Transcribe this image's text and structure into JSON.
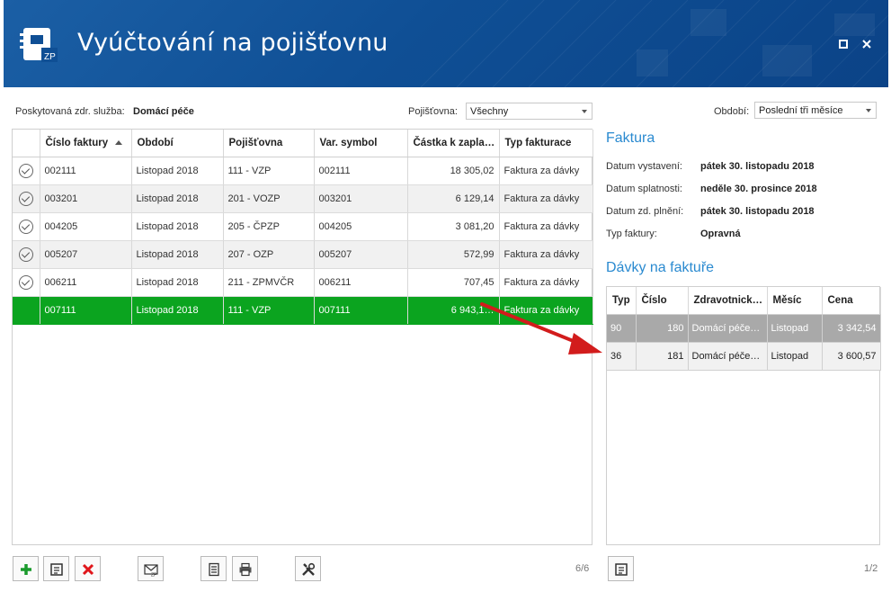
{
  "window": {
    "title": "Vyúčtování na pojišťovnu",
    "logo_text": "ZP"
  },
  "filters": {
    "service_label": "Poskytovaná zdr. služba:",
    "service_value": "Domácí péče",
    "insurer_label": "Pojišťovna:",
    "insurer_value": "Všechny",
    "period_label": "Období:",
    "period_value": "Poslední tři měsíce"
  },
  "invoices": {
    "columns": [
      "Číslo faktury",
      "Období",
      "Pojišťovna",
      "Var. symbol",
      "Částka k zapla…",
      "Typ fakturace"
    ],
    "rows": [
      {
        "cislo": "002111",
        "obdobi": "Listopad 2018",
        "pojistovna": "111 - VZP",
        "vs": "002111",
        "castka": "18 305,02",
        "typ": "Faktura za dávky"
      },
      {
        "cislo": "003201",
        "obdobi": "Listopad 2018",
        "pojistovna": "201 - VOZP",
        "vs": "003201",
        "castka": "6 129,14",
        "typ": "Faktura za dávky"
      },
      {
        "cislo": "004205",
        "obdobi": "Listopad 2018",
        "pojistovna": "205 - ČPZP",
        "vs": "004205",
        "castka": "3 081,20",
        "typ": "Faktura za dávky"
      },
      {
        "cislo": "005207",
        "obdobi": "Listopad 2018",
        "pojistovna": "207 - OZP",
        "vs": "005207",
        "castka": "572,99",
        "typ": "Faktura za dávky"
      },
      {
        "cislo": "006211",
        "obdobi": "Listopad 2018",
        "pojistovna": "211 - ZPMVČR",
        "vs": "006211",
        "castka": "707,45",
        "typ": "Faktura za dávky"
      },
      {
        "cislo": "007111",
        "obdobi": "Listopad 2018",
        "pojistovna": "111 - VZP",
        "vs": "007111",
        "castka": "6 943,1…",
        "typ": "Faktura za dávky"
      }
    ],
    "counter": "6/6"
  },
  "invoice_detail": {
    "title": "Faktura",
    "fields": [
      {
        "label": "Datum vystavení:",
        "value": "pátek 30. listopadu 2018"
      },
      {
        "label": "Datum splatnosti:",
        "value": "neděle 30. prosince 2018"
      },
      {
        "label": "Datum zd. plnění:",
        "value": "pátek 30. listopadu 2018"
      },
      {
        "label": "Typ faktury:",
        "value": "Opravná"
      }
    ]
  },
  "batches": {
    "title": "Dávky na faktuře",
    "columns": [
      "Typ",
      "Číslo",
      "Zdravotnick…",
      "Měsíc",
      "Cena"
    ],
    "rows": [
      {
        "typ": "90",
        "cislo": "180",
        "zdrav": "Domácí péče…",
        "mesic": "Listopad",
        "cena": "3 342,54"
      },
      {
        "typ": "36",
        "cislo": "181",
        "zdrav": "Domácí péče…",
        "mesic": "Listopad",
        "cena": "3 600,57"
      }
    ],
    "counter": "1/2"
  },
  "colors": {
    "title_bar": "#0f4f95",
    "selected_row": "#0ba41f",
    "section_title": "#2a8ad0",
    "arrow": "#d21c1c"
  },
  "toolbar_icons": [
    "plus-icon",
    "edit-document-icon",
    "delete-icon",
    "mail-zp-icon",
    "document-icon",
    "print-icon",
    "tools-icon",
    "batch-edit-icon"
  ]
}
